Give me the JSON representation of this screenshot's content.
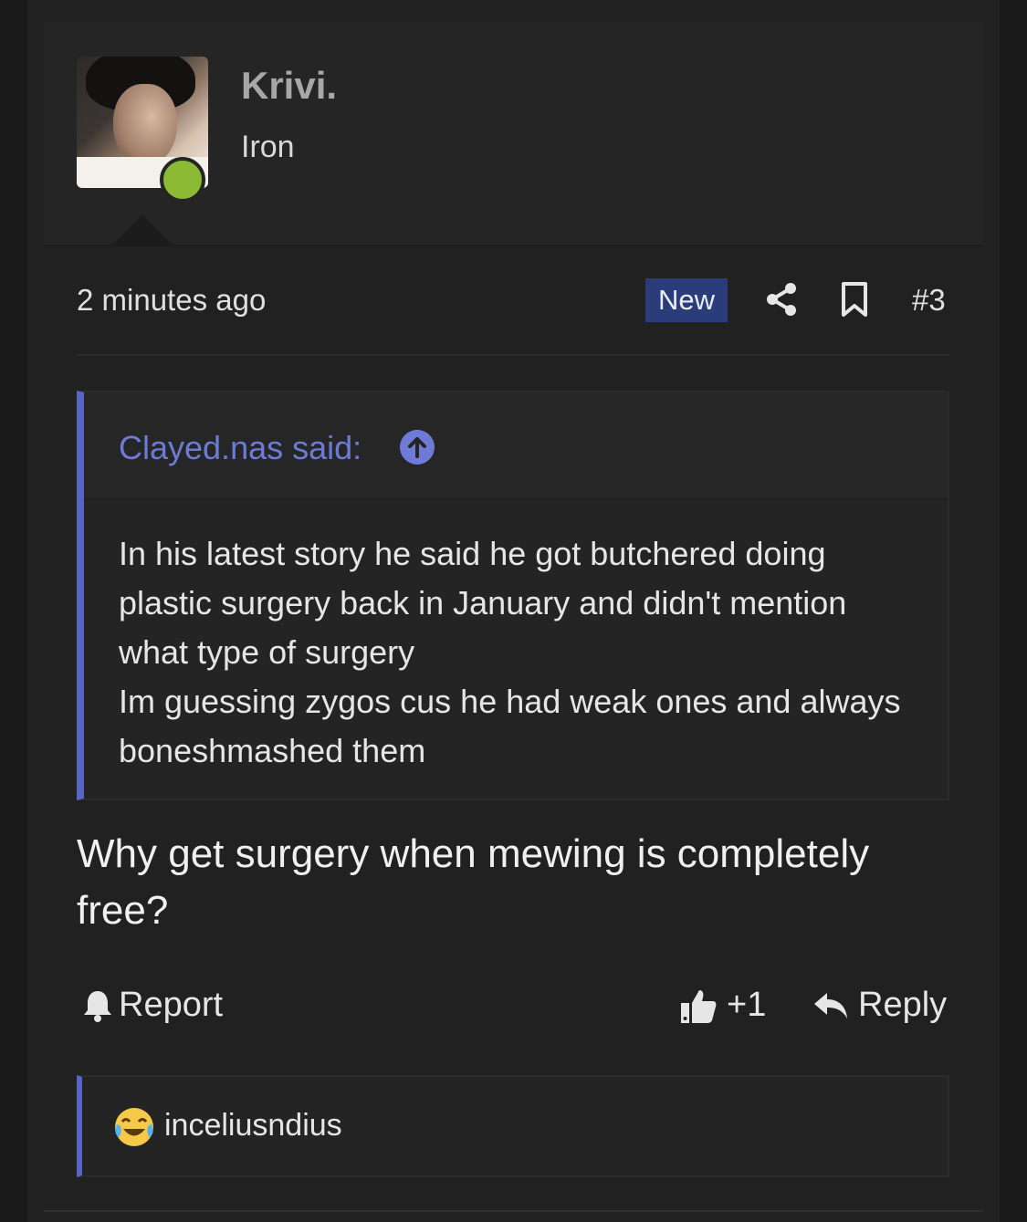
{
  "author": {
    "name": "Krivi.",
    "title": "Iron",
    "status": "online",
    "status_color": "#8dba34"
  },
  "meta": {
    "timestamp": "2 minutes ago",
    "badge": "New",
    "post_number": "#3"
  },
  "quote": {
    "author_said": "Clayed.nas said:",
    "lines": [
      "In his latest story he said he got butchered doing plastic surgery back in January and didn't mention what type of surgery",
      "Im guessing zygos cus he had weak ones and always boneshmashed them"
    ]
  },
  "post": {
    "text": "Why get surgery when mewing is completely free?"
  },
  "actions": {
    "report_label": "Report",
    "like_count": "+1",
    "reply_label": "Reply"
  },
  "reactions": {
    "emoji": "joy-tears-icon",
    "users": "inceliusndius"
  },
  "colors": {
    "accent": "#5865c4",
    "link": "#6d7bd6",
    "badge_bg": "#2a3d7a",
    "background": "#212121"
  }
}
